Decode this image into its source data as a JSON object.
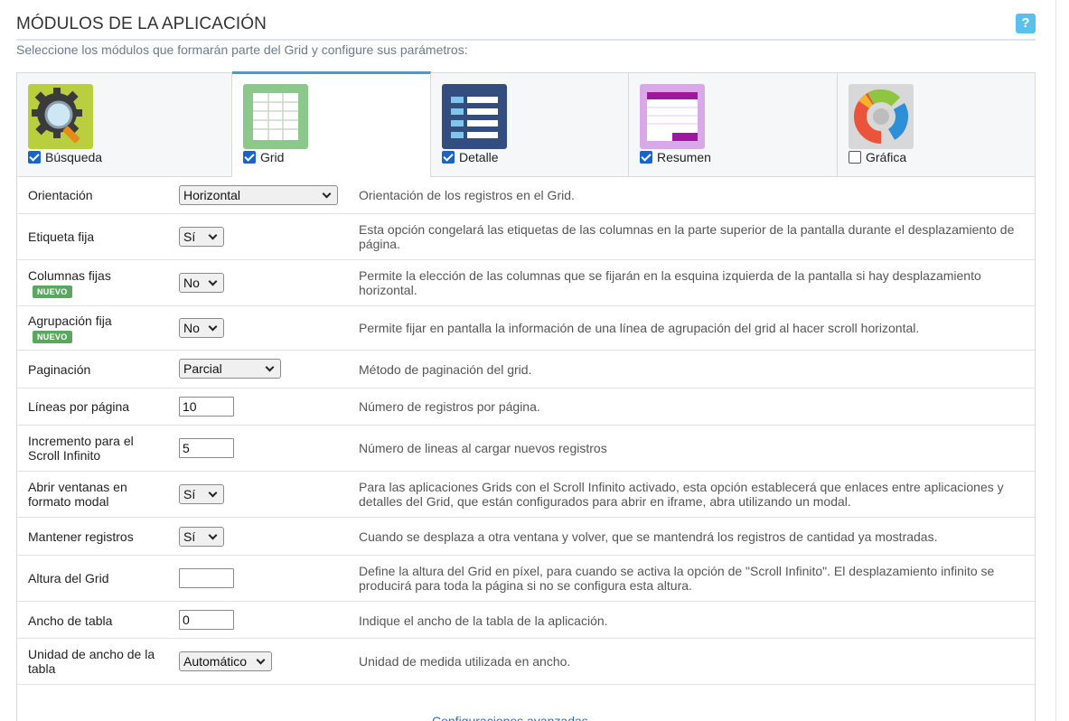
{
  "header": {
    "title": "MÓDULOS DE LA APLICACIÓN",
    "help_label": "?",
    "subtitle": "Seleccione los módulos que formarán parte del Grid y configure sus parámetros:"
  },
  "tabs": [
    {
      "label": "Búsqueda",
      "checked": true,
      "icon": "magnifier-gear-icon"
    },
    {
      "label": "Grid",
      "checked": true,
      "icon": "grid-table-icon"
    },
    {
      "label": "Detalle",
      "checked": true,
      "icon": "detail-list-icon"
    },
    {
      "label": "Resumen",
      "checked": true,
      "icon": "summary-table-icon"
    },
    {
      "label": "Gráfica",
      "checked": false,
      "icon": "donut-chart-icon"
    }
  ],
  "badge_new": "NUEVO",
  "rows": [
    {
      "label": "Orientación",
      "value": "Horizontal",
      "desc": "Orientación de los registros en el Grid."
    },
    {
      "label": "Etiqueta fija",
      "value": "Sí",
      "desc": "Esta opción congelará las etiquetas de las columnas en la parte superior de la pantalla durante el desplazamiento de página."
    },
    {
      "label": "Columnas fijas",
      "value": "No",
      "desc": "Permite la elección de las columnas que se fijarán en la esquina izquierda de la pantalla si hay desplazamiento horizontal."
    },
    {
      "label": "Agrupación fija",
      "value": "No",
      "desc": "Permite fijar en pantalla la información de una línea de agrupación del grid al hacer scroll horizontal."
    },
    {
      "label": "Paginación",
      "value": "Parcial",
      "desc": "Método de paginación del grid."
    },
    {
      "label": "Líneas por página",
      "value": "10",
      "desc": "Número de registros por página."
    },
    {
      "label": "Incremento para el Scroll Infinito",
      "value": "5",
      "desc": "Número de lineas al cargar nuevos registros"
    },
    {
      "label": "Abrir ventanas en formato modal",
      "value": "Sí",
      "desc": "Para las aplicaciones Grids con el Scroll Infinito activado, esta opción establecerá que enlaces entre aplicaciones y detalles del Grid, que están configurados para abrir en iframe, abra utilizando un modal."
    },
    {
      "label": "Mantener registros",
      "value": "Sí",
      "desc": "Cuando se desplaza a otra ventana y volver, que se mantendrá los registros de cantidad ya mostradas."
    },
    {
      "label": "Altura del Grid",
      "value": "",
      "desc": "Define la altura del Grid en píxel, para cuando se activa la opción de \"Scroll Infinito\". El desplazamiento infinito se producirá para toda la página si no se configura esta altura."
    },
    {
      "label": "Ancho de tabla",
      "value": "0",
      "desc": "Indique el ancho de la tabla de la aplicación."
    },
    {
      "label": "Unidad de ancho de la tabla",
      "value": "Automático",
      "desc": "Unidad de medida utilizada en ancho."
    }
  ],
  "advanced_link": "Configuraciones avanzadas"
}
